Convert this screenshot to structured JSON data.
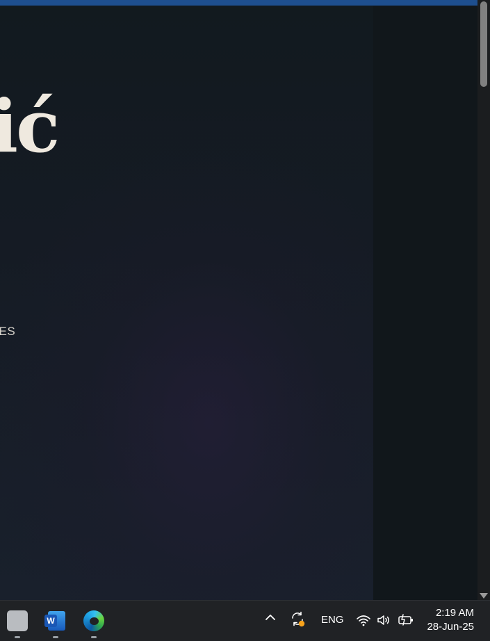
{
  "page": {
    "hero_title": "lić",
    "subtitle": "ONES"
  },
  "taskbar": {
    "apps": [
      {
        "name": "blank-app",
        "label": ""
      },
      {
        "name": "word",
        "label": "W"
      },
      {
        "name": "edge",
        "label": ""
      }
    ],
    "tray": {
      "language": "ENG"
    },
    "clock": {
      "time": "2:19 AM",
      "date": "28-Jun-25"
    }
  },
  "colors": {
    "top_strip": "#1e4f8f",
    "page_bg": "#121a1f",
    "hero_text": "#efe9df",
    "taskbar_bg": "#202225",
    "notification_dot": "#f7a21b"
  },
  "icons": [
    "chevron-up-icon",
    "sync-icon",
    "wifi-icon",
    "volume-icon",
    "battery-icon"
  ]
}
